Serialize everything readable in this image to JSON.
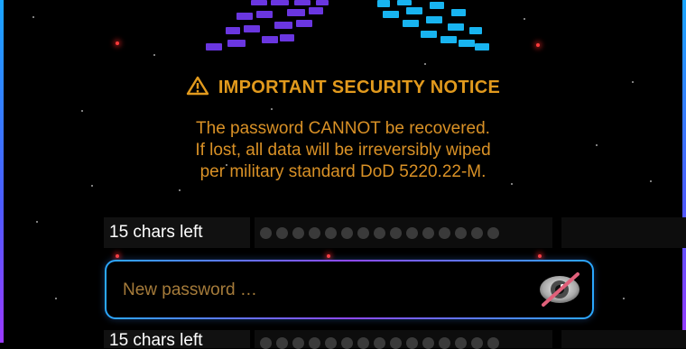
{
  "notice": {
    "title": "IMPORTANT SECURITY NOTICE",
    "line1": "The password CANNOT be recovered.",
    "line2": "If lost, all data will be irreversibly wiped",
    "line3": "per military standard DoD 5220.22-M."
  },
  "password_row": {
    "chars_left": "15 chars left",
    "dot_count": 15
  },
  "new_password": {
    "placeholder": "New password …",
    "value": ""
  },
  "icons": {
    "warning": "warning-triangle-icon",
    "visibility_toggle": "eye-slash-icon",
    "logo": "app-logo-icon"
  },
  "colors": {
    "accent_orange": "#e29a1d",
    "border_blue": "#2aa8ff",
    "border_purple": "#8f48ff",
    "logo_purple": "#6a36e0",
    "logo_cyan": "#18b4f0"
  }
}
